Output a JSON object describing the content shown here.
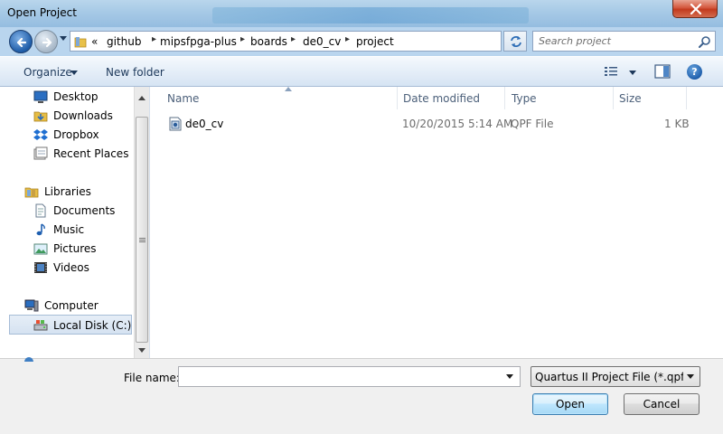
{
  "window": {
    "title": "Open Project",
    "close_label": "Close"
  },
  "address": {
    "history_glyph": "«",
    "breadcrumbs": [
      "github",
      "mipsfpga-plus",
      "boards",
      "de0_cv",
      "project"
    ]
  },
  "search": {
    "placeholder": "Search project"
  },
  "toolbar": {
    "organize_label": "Organize",
    "new_folder_label": "New folder"
  },
  "nav": {
    "favorites": [
      {
        "label": "Desktop",
        "icon": "desktop-icon"
      },
      {
        "label": "Downloads",
        "icon": "downloads-icon"
      },
      {
        "label": "Dropbox",
        "icon": "dropbox-icon"
      },
      {
        "label": "Recent Places",
        "icon": "recent-places-icon"
      }
    ],
    "libraries_label": "Libraries",
    "libraries": [
      {
        "label": "Documents",
        "icon": "documents-icon"
      },
      {
        "label": "Music",
        "icon": "music-icon"
      },
      {
        "label": "Pictures",
        "icon": "pictures-icon"
      },
      {
        "label": "Videos",
        "icon": "videos-icon"
      }
    ],
    "computer_label": "Computer",
    "drives": [
      {
        "label": "Local Disk (C:)",
        "icon": "local-disk-icon",
        "selected": true
      }
    ]
  },
  "columns": {
    "name": "Name",
    "date_modified": "Date modified",
    "type": "Type",
    "size": "Size"
  },
  "files": [
    {
      "name": "de0_cv",
      "date_modified": "10/20/2015 5:14 AM",
      "type": "QPF File",
      "size": "1 KB",
      "icon": "qpf-file-icon"
    }
  ],
  "bottom": {
    "file_name_label": "File name:",
    "file_name_value": "",
    "file_type_selected": "Quartus II Project File (*.qpf *.q",
    "open_label": "Open",
    "cancel_label": "Cancel"
  },
  "colors": {
    "accent": "#3c7fb1",
    "titlebar": "#a6c9e6",
    "address_bar": "#b9d5ee"
  }
}
